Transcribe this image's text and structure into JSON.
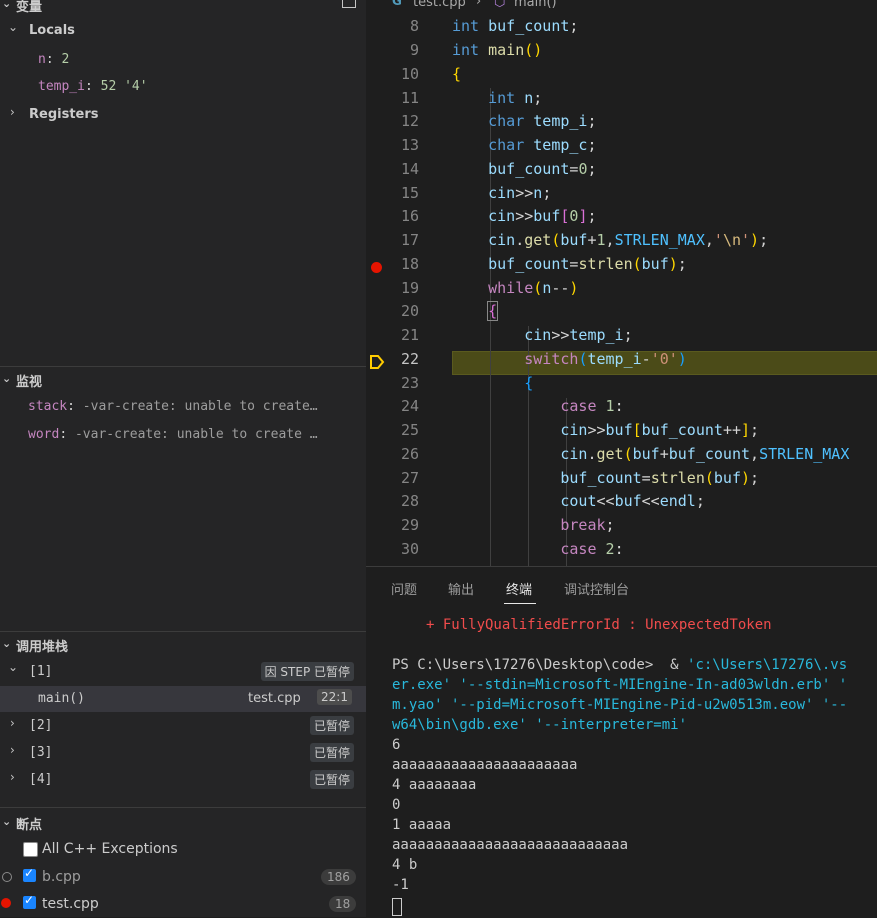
{
  "left": {
    "variables": {
      "title": "变量",
      "locals_label": "Locals",
      "registers_label": "Registers",
      "locals": [
        {
          "name": "n",
          "value": "2"
        },
        {
          "name": "temp_i",
          "value": "52 '4'"
        }
      ]
    },
    "watch": {
      "title": "监视",
      "items": [
        {
          "name": "stack",
          "value": "-var-create: unable to create…"
        },
        {
          "name": "word",
          "value": "-var-create: unable to create …"
        }
      ]
    },
    "callstack": {
      "title": "调用堆栈",
      "threads": [
        {
          "label": "[1]",
          "status": "因 STEP 已暂停"
        },
        {
          "label": "[2]",
          "status": "已暂停"
        },
        {
          "label": "[3]",
          "status": "已暂停"
        },
        {
          "label": "[4]",
          "status": "已暂停"
        }
      ],
      "frame": {
        "name": "main()",
        "file": "test.cpp",
        "pos": "22:1"
      }
    },
    "breakpoints": {
      "title": "断点",
      "items": [
        {
          "label": "All C++ Exceptions",
          "count": ""
        },
        {
          "label": "b.cpp",
          "count": "186"
        },
        {
          "label": "test.cpp",
          "count": "18"
        }
      ]
    }
  },
  "editor": {
    "breadcrumb": {
      "file": "test.cpp",
      "symbol": "main()"
    },
    "line_numbers": [
      "8",
      "9",
      "10",
      "11",
      "12",
      "13",
      "14",
      "15",
      "16",
      "17",
      "18",
      "19",
      "20",
      "21",
      "22",
      "23",
      "24",
      "25",
      "26",
      "27",
      "28",
      "29",
      "30"
    ],
    "breakpoint_line": "18",
    "current_line": "22"
  },
  "panel": {
    "tabs": [
      "问题",
      "输出",
      "终端",
      "调试控制台"
    ],
    "active_tab": "终端",
    "terminal": {
      "error": "+ FullyQualifiedErrorId : UnexpectedToken",
      "prompt": "PS C:\\Users\\17276\\Desktop\\code>  & ",
      "cmd1": "'c:\\Users\\17276\\.vs",
      "cmd2": "er.exe' '--stdin=Microsoft-MIEngine-In-ad03wldn.erb' '",
      "cmd3": "m.yao' '--pid=Microsoft-MIEngine-Pid-u2w0513m.eow' '--",
      "cmd4": "w64\\bin\\gdb.exe' '--interpreter=mi'",
      "output": [
        "6",
        "aaaaaaaaaaaaaaaaaaaaaa",
        "4 aaaaaaaa",
        "0",
        "1 aaaaa",
        "aaaaaaaaaaaaaaaaaaaaaaaaaaaa",
        "4 b",
        "-1"
      ]
    }
  },
  "colors": {
    "breakpoint": "#e51400",
    "current_line_arrow": "#ffcc00",
    "current_line_bg": "#4b4b18",
    "checkbox": "#1a85ff"
  }
}
